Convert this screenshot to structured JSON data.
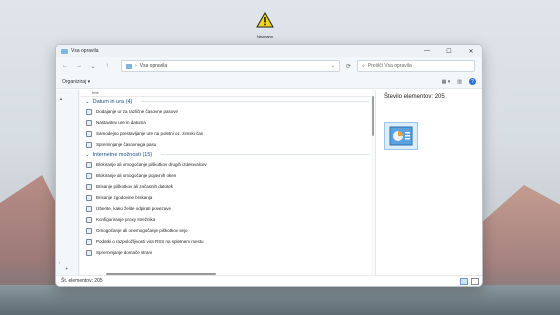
{
  "desktop": {
    "icon_label": "Neznano"
  },
  "window": {
    "title": "Vsa opravila",
    "controls": {
      "minimize": "—",
      "maximize": "☐",
      "close": "✕"
    }
  },
  "nav": {
    "back": "←",
    "forward": "→",
    "dropdown": "⌄",
    "up": "↑",
    "breadcrumb_sep": "›",
    "address": "Vsa opravila",
    "address_dropdown": "⌄",
    "refresh": "⟳",
    "search_placeholder": "Preišči Vsa opravila"
  },
  "commandbar": {
    "organize": "Organiziraj ▾",
    "view_icon": "▦ ▾",
    "pane_icon": "▥"
  },
  "list": {
    "column_header": "Ime",
    "groups": [
      {
        "title": "Datum in ura (4)",
        "items": [
          "Dodajanje ur za različne časovne pasove",
          "Nastavitev ure in datuma",
          "Samodejno prestavljanje ure na poletni oz. zimski čas",
          "Spreminjanje časovnega pasu"
        ]
      },
      {
        "title": "Internetne možnosti (15)",
        "items": [
          "Blokiranje ali omogočanje piškotkov drugih izdelovalcev",
          "Blokiranje ali omogočanje pojavnih oken",
          "Brisanje piškotkov ali začasnih datotek",
          "Brisanje zgodovine brskanja",
          "Izberite, kako želite odpirati povezave",
          "Konfiguriranje proxy strežnika",
          "Omogočanje ali onemogočanje piškotkov sejo",
          "Podatki o razpoložljivosti vira RSS na spletnem mestu",
          "Sprerninjanje domače strani"
        ]
      }
    ]
  },
  "details": {
    "count_text": "Število elementov: 205"
  },
  "status": {
    "count_text": "Št. elementov: 205"
  },
  "colors": {
    "accent": "#2b6fd8",
    "group_header": "#1f4e8c"
  }
}
